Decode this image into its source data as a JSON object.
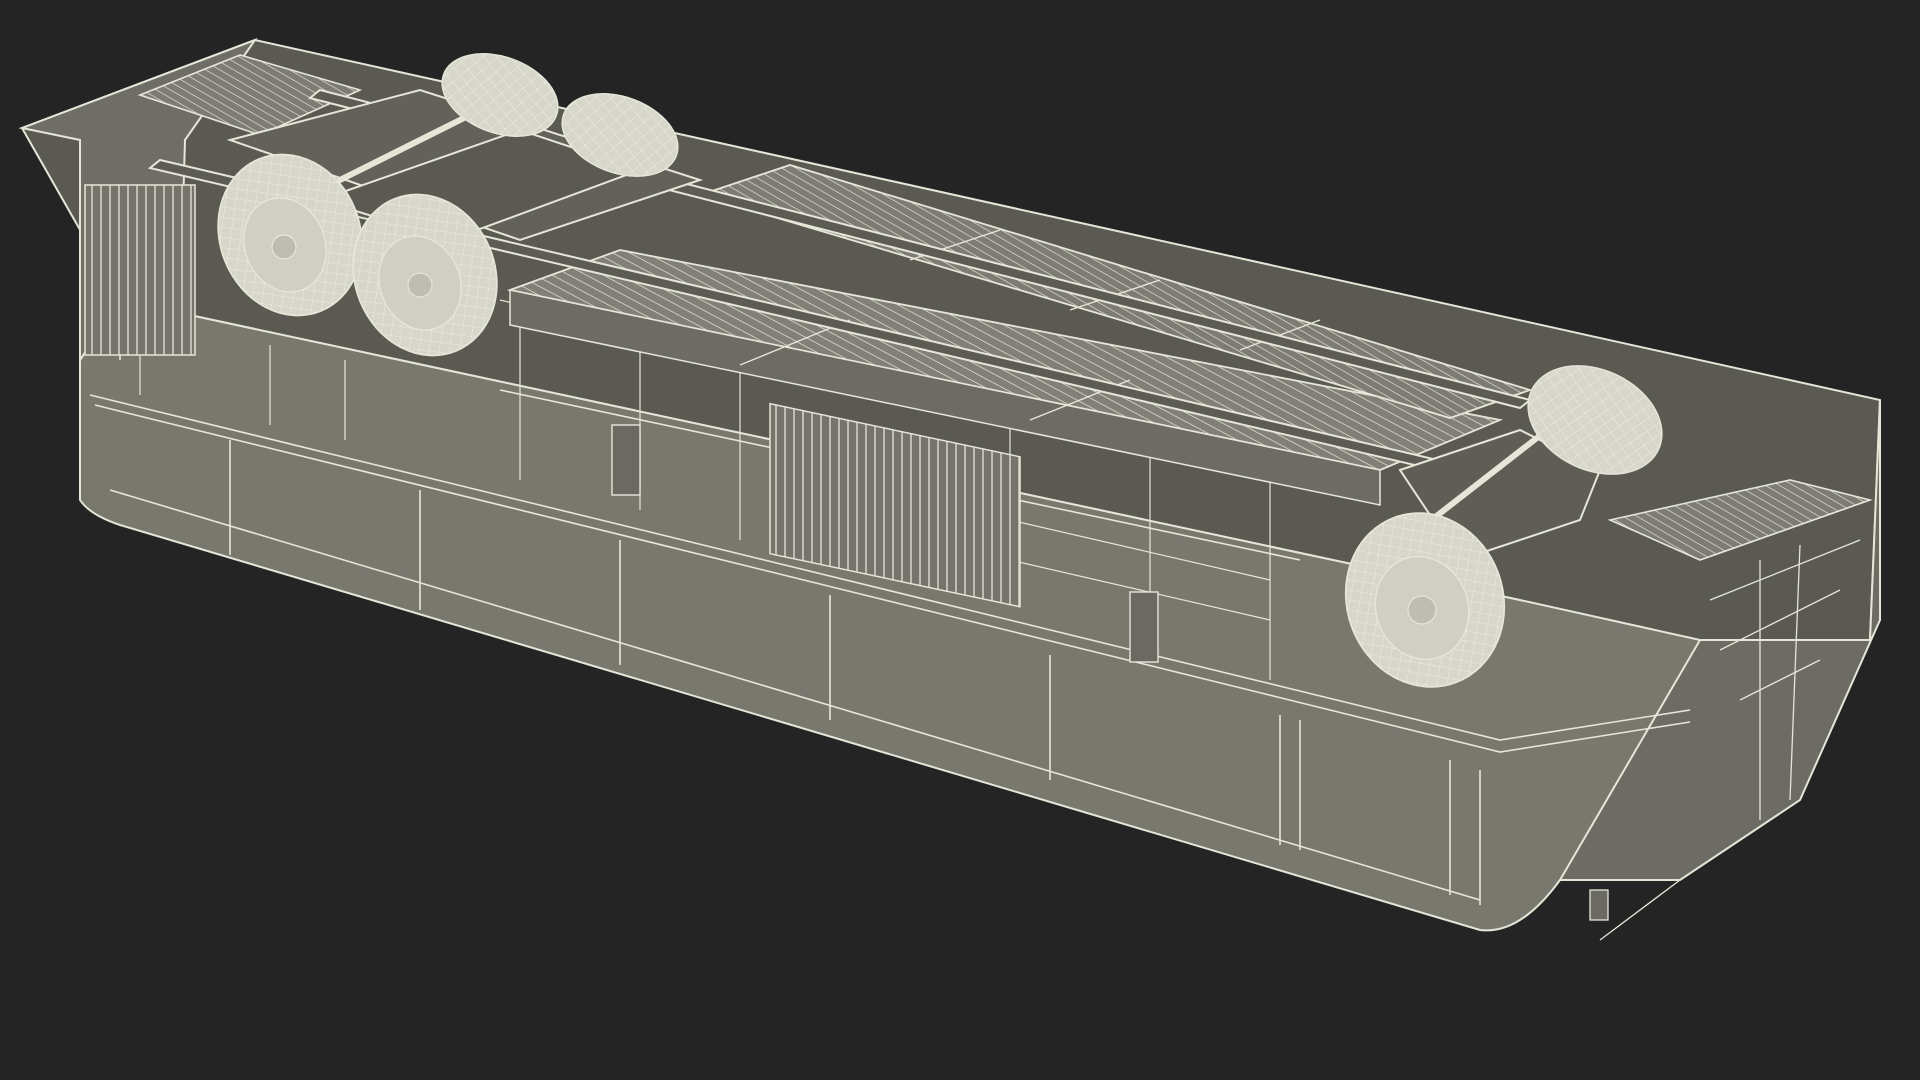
{
  "viewport": {
    "background": "#242424"
  },
  "model": {
    "subject": "overturned-bus-wireframe-render",
    "colors": {
      "body_fill": "#7a7a70",
      "body_fill_dark": "#66665e",
      "body_fill_light": "#8c8c82",
      "wire": "#e6e6d8",
      "wire_faint": "#c9c9bb",
      "tire": "#d8d8cc",
      "tire_shadow": "#b9b9ad",
      "cavity": "#4b4b45"
    }
  }
}
